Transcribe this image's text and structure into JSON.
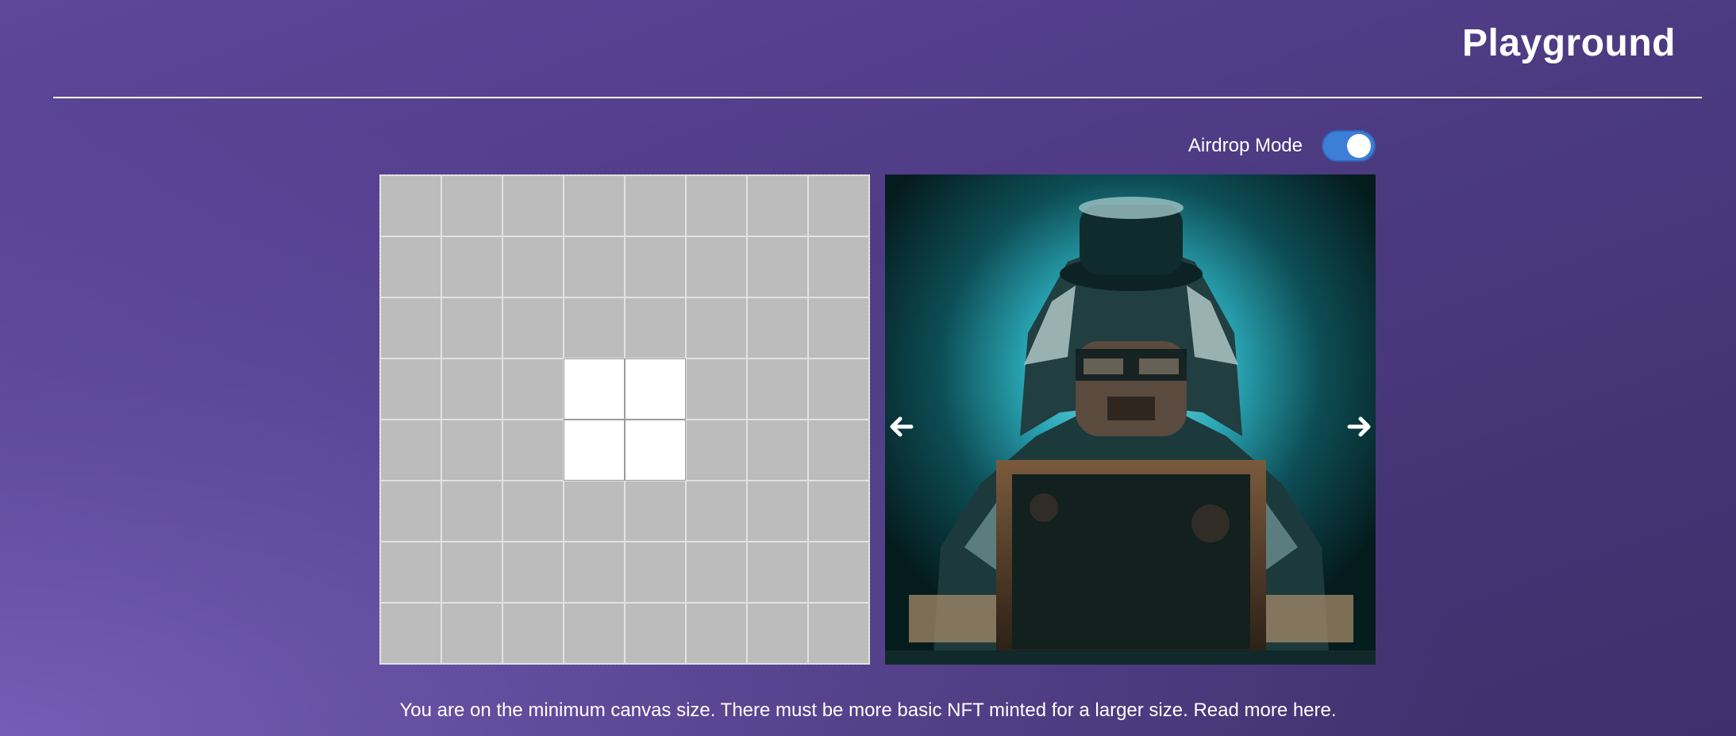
{
  "header": {
    "title": "Playground"
  },
  "airdrop": {
    "label": "Airdrop Mode",
    "enabled": true
  },
  "canvas": {
    "rows": 8,
    "cols": 8,
    "filled_cells": [
      [
        3,
        3
      ],
      [
        3,
        4
      ],
      [
        4,
        3
      ],
      [
        4,
        4
      ]
    ]
  },
  "footer": {
    "note": "You are on the minimum canvas size. There must be more basic NFT minted for a larger size. Read more here."
  },
  "icons": {
    "prev": "arrow-left-icon",
    "next": "arrow-right-icon"
  },
  "colors": {
    "toggle_on": "#3d7ed6",
    "cell_empty": "#bcbcbc",
    "cell_filled": "#ffffff"
  }
}
